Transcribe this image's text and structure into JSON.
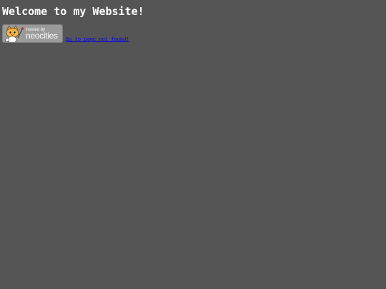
{
  "page": {
    "title": "Welcome to my Website!",
    "background_color": "#555555"
  },
  "badge": {
    "small_text": "hosted by",
    "brand_text": "neocities",
    "icon": "neocities-cat-icon"
  },
  "link": {
    "label": "Go to page not found!",
    "color": "#0000ee"
  }
}
